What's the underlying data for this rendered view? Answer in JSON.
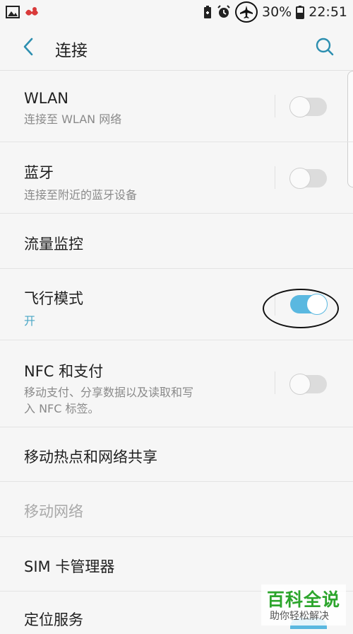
{
  "status_bar": {
    "battery_percent": "30%",
    "time": "22:51"
  },
  "toolbar": {
    "title": "连接"
  },
  "settings": [
    {
      "title": "WLAN",
      "subtitle": "连接至 WLAN 网络",
      "toggle": false
    },
    {
      "title": "蓝牙",
      "subtitle": "连接至附近的蓝牙设备",
      "toggle": false
    },
    {
      "title": "流量监控"
    },
    {
      "title": "飞行模式",
      "subtitle": "开",
      "toggle": true
    },
    {
      "title": "NFC 和支付",
      "subtitle_line1": "移动支付、分享数据以及读取和写",
      "subtitle_line2": "入 NFC 标签。",
      "toggle": false
    },
    {
      "title": "移动热点和网络共享"
    },
    {
      "title": "移动网络",
      "disabled": true
    },
    {
      "title": "SIM 卡管理器"
    },
    {
      "title": "定位服务",
      "toggle": true
    }
  ],
  "watermark": {
    "title": "百科全说",
    "subtitle": "助你轻松解决"
  },
  "colors": {
    "accent": "#5ab8e0",
    "accent_text": "#4aa7c6",
    "background": "#f6f6f6",
    "watermark_green": "#2ca52c"
  }
}
